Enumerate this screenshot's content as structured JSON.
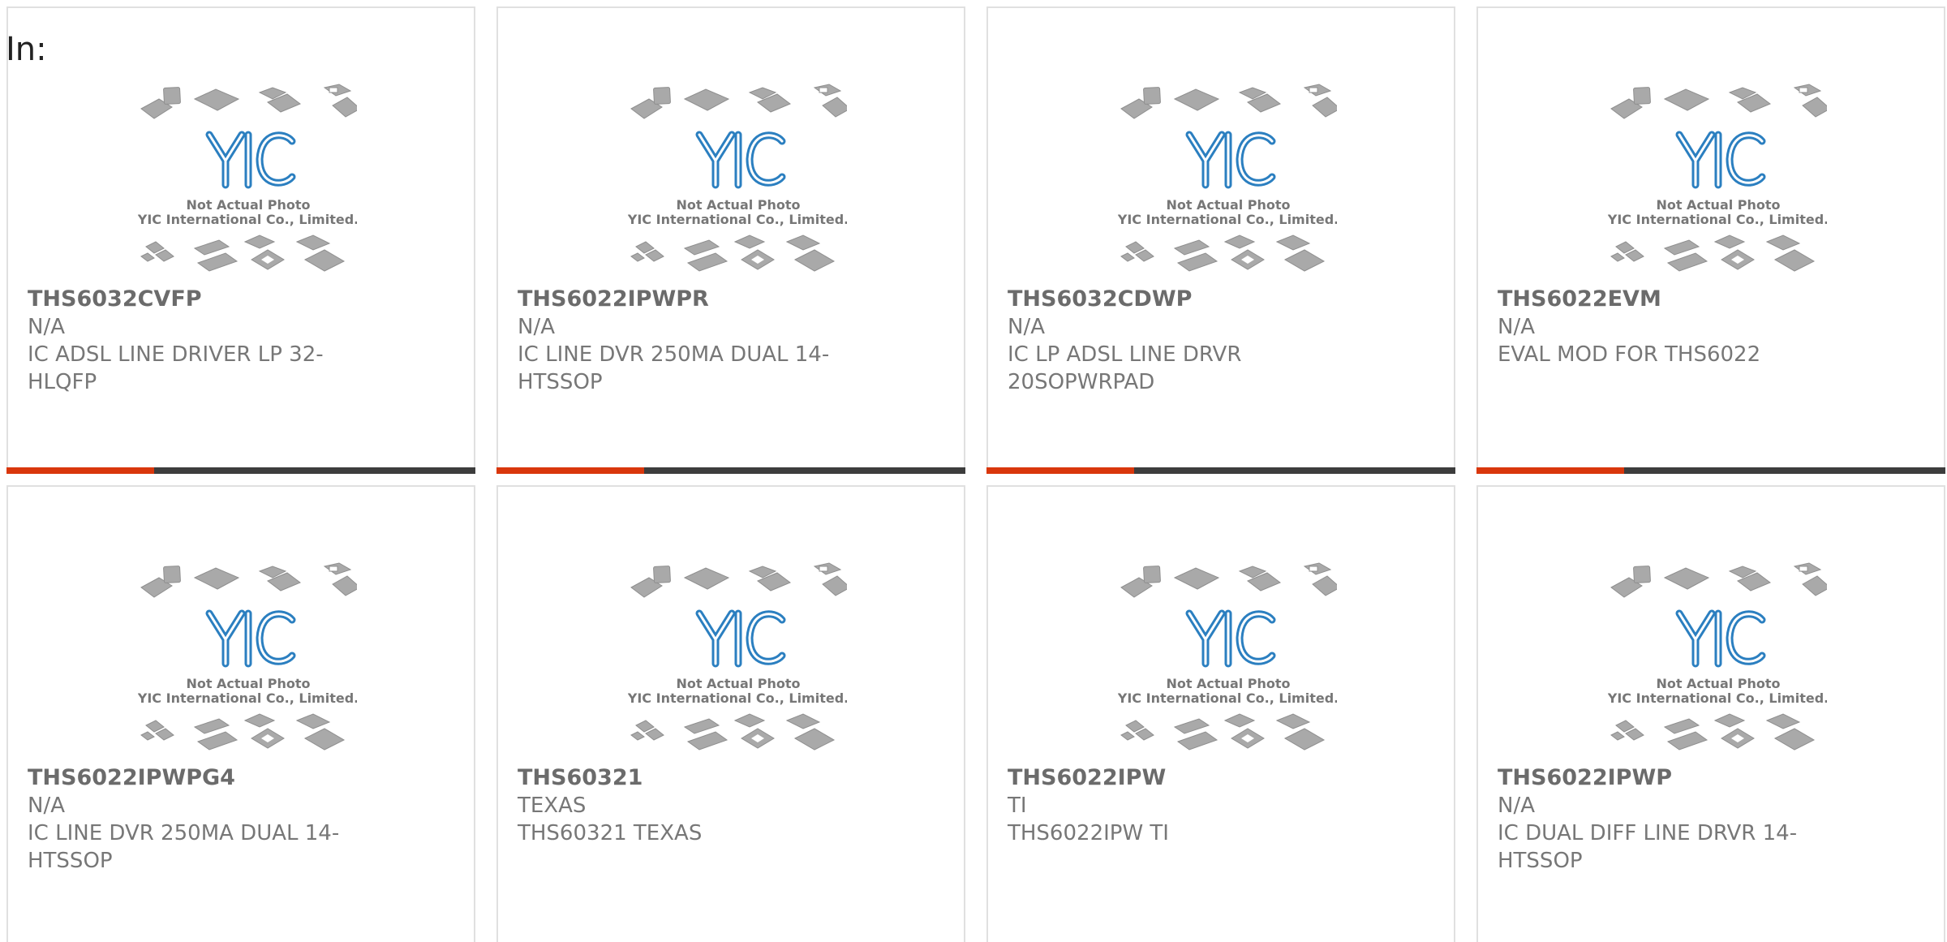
{
  "search": {
    "prefix_label": "In:"
  },
  "colors": {
    "accent": "#d9370c",
    "bar_dark": "#3d3d3d",
    "logo_blue": "#2b7fc0"
  },
  "photo": {
    "icon": "chip-placeholder-icon",
    "line1": "Not Actual Photo",
    "line2": "YIC International Co., Limited.",
    "logo_text": "YIC"
  },
  "products": [
    {
      "part_number": "THS6032CVFP",
      "manufacturer": "N/A",
      "description": "IC ADSL LINE DRIVER LP 32-HLQFP"
    },
    {
      "part_number": "THS6022IPWPR",
      "manufacturer": "N/A",
      "description": "IC LINE DVR 250MA DUAL 14-HTSSOP"
    },
    {
      "part_number": "THS6032CDWP",
      "manufacturer": "N/A",
      "description": "IC LP ADSL LINE DRVR 20SOPWRPAD"
    },
    {
      "part_number": "THS6022EVM",
      "manufacturer": "N/A",
      "description": "EVAL MOD FOR THS6022"
    },
    {
      "part_number": "THS6022IPWPG4",
      "manufacturer": "N/A",
      "description": "IC LINE DVR 250MA DUAL 14-HTSSOP"
    },
    {
      "part_number": "THS60321",
      "manufacturer": "TEXAS",
      "description": "THS60321 TEXAS"
    },
    {
      "part_number": "THS6022IPW",
      "manufacturer": "TI",
      "description": "THS6022IPW TI"
    },
    {
      "part_number": "THS6022IPWP",
      "manufacturer": "N/A",
      "description": "IC DUAL DIFF LINE DRVR 14-HTSSOP"
    }
  ]
}
